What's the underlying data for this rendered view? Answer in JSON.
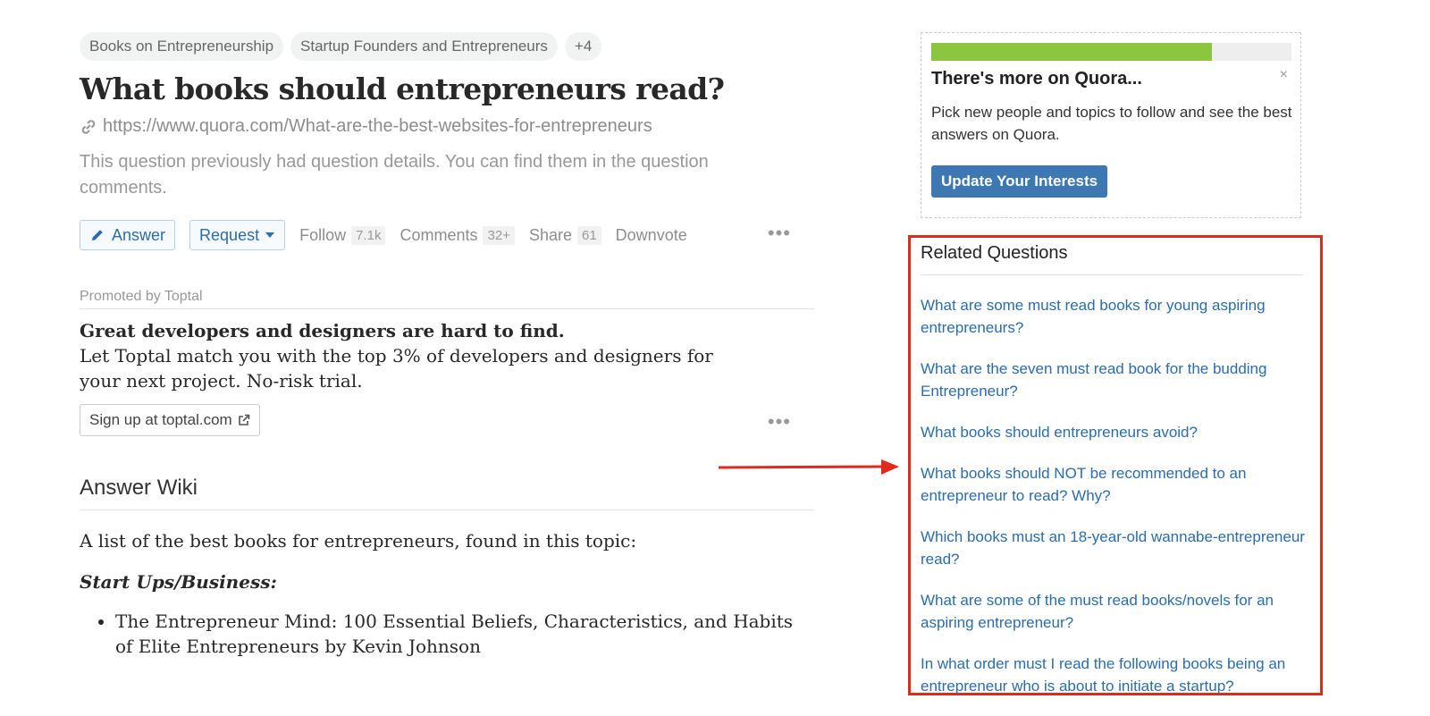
{
  "topics": [
    "Books on Entrepreneurship",
    "Startup Founders and Entrepreneurs",
    "+4"
  ],
  "question": {
    "title": "What books should entrepreneurs read?",
    "url": "https://www.quora.com/What-are-the-best-websites-for-entrepreneurs",
    "details": "This question previously had question details. You can find them in the question comments."
  },
  "actions": {
    "answer": "Answer",
    "request": "Request",
    "follow": "Follow",
    "follow_count": "7.1k",
    "comments": "Comments",
    "comments_count": "32+",
    "share": "Share",
    "share_count": "61",
    "downvote": "Downvote",
    "more": "•••"
  },
  "promo": {
    "label": "Promoted by Toptal",
    "headline": "Great developers and designers are hard to find.",
    "body": "Let Toptal match you with the top 3% of developers and designers for your next project. No-risk trial.",
    "cta": "Sign up at toptal.com",
    "more": "•••"
  },
  "wiki": {
    "title": "Answer Wiki",
    "intro": "A list of the best books for entrepreneurs, found in this topic:",
    "subheading": "Start Ups/Business:",
    "items": [
      "The Entrepreneur Mind: 100 Essential Beliefs, Characteristics, and Habits of Elite Entrepreneurs by Kevin Johnson"
    ]
  },
  "sidebar": {
    "progress": 0.78,
    "title": "There's more on Quora...",
    "close": "×",
    "text": "Pick new people and topics to follow and see the best answers on Quora.",
    "button": "Update Your Interests"
  },
  "related": {
    "title": "Related Questions",
    "items": [
      "What are some must read books for young aspiring entrepreneurs?",
      "What are the seven must read book for the budding Entrepreneur?",
      "What books should entrepreneurs avoid?",
      "What books should NOT be recommended to an entrepreneur to read? Why?",
      "Which books must an 18-year-old wannabe-entrepreneur read?",
      "What are some of the must read books/novels for an aspiring entrepreneur?",
      "In what order must I read the following books being an entrepreneur who is about to initiate a startup?"
    ]
  },
  "colors": {
    "link": "#2b6dad",
    "highlight": "#e02a1c",
    "progress": "#8cc63f"
  }
}
